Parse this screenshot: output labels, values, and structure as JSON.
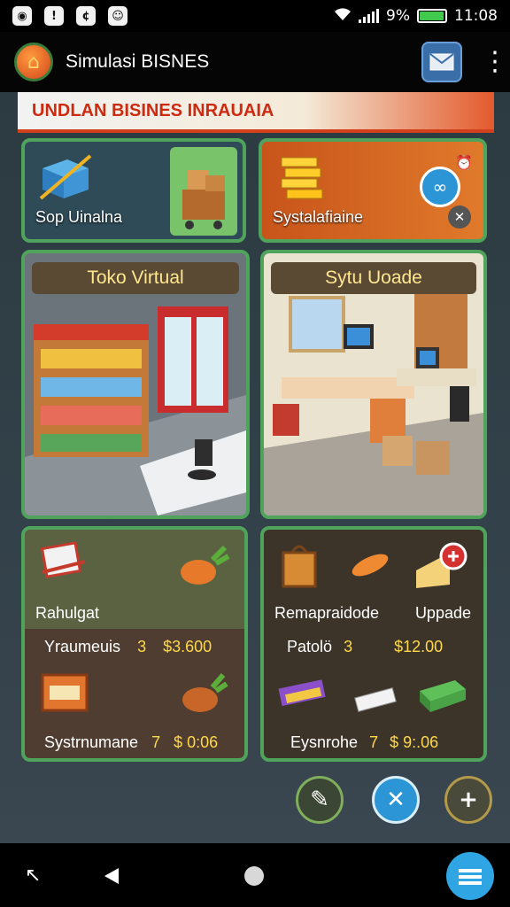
{
  "status_bar": {
    "icons": [
      "circle-status-icon",
      "notification-icon",
      "message-icon",
      "app-icon"
    ],
    "battery_percent": "9%",
    "time": "11:08",
    "battery_fill": 0.9
  },
  "app_bar": {
    "title": "Simulasi BISNES",
    "logo_icon": "home-icon",
    "mail_icon": "mail-icon",
    "menu_icon": "more-vert-icon"
  },
  "banner": {
    "text": "UNDLAN BISINES INRAUAIA"
  },
  "top_cards": [
    {
      "label": "Sop Uinalna",
      "icon": "box-icon"
    },
    {
      "label": "Systalafiaine",
      "icon": "gold-bars-icon"
    }
  ],
  "mid_cards": [
    {
      "title": "Toko Virtual"
    },
    {
      "title": "Sytu Uoade"
    }
  ],
  "bottom_left": {
    "header_label": "Rahulgat",
    "row1": {
      "name": "Yraumeuis",
      "count": "3",
      "price": "$3.600"
    },
    "row2": {
      "name": "Systrnumane",
      "count": "7",
      "price": "$ 0:06"
    }
  },
  "bottom_right": {
    "header_label_left": "Remapraidode",
    "header_label_right": "Uppade",
    "row1": {
      "name": "Patolö",
      "count": "3",
      "price": "$12.00"
    },
    "row2": {
      "name": "Eysnrohe",
      "count": "7",
      "price": "$ 9:.06"
    }
  },
  "actions": [
    {
      "icon": "edit-icon"
    },
    {
      "icon": "close-icon"
    },
    {
      "icon": "add-icon"
    }
  ],
  "colors": {
    "card_border": "#4fa35b",
    "banner_text": "#cc2b11",
    "price_accent": "#ffd84a",
    "fab_blue": "#2c95d6"
  }
}
